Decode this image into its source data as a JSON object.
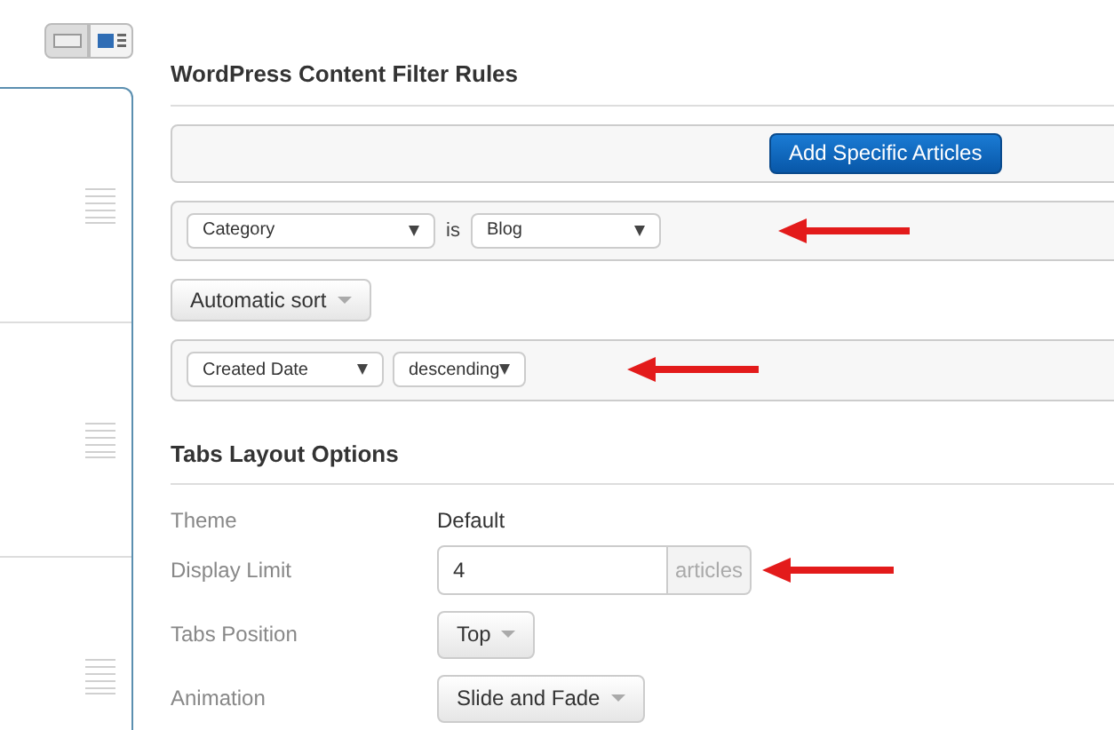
{
  "view_toggle": [
    {
      "kind": "plain",
      "selected": false
    },
    {
      "kind": "list",
      "selected": true
    }
  ],
  "filter_rules": {
    "title": "WordPress Content Filter Rules",
    "add_button": "Add Specific Articles",
    "condition": {
      "field": "Category",
      "operator": "is",
      "value": "Blog"
    },
    "sort_button": "Automatic sort",
    "sort": {
      "field": "Created Date",
      "order": "descending"
    }
  },
  "layout_options": {
    "title": "Tabs Layout Options",
    "rows": [
      {
        "kind": "text",
        "label": "Theme",
        "value": "Default"
      },
      {
        "kind": "input",
        "label": "Display Limit",
        "value": "4",
        "addon": "articles"
      },
      {
        "kind": "dropdown",
        "label": "Tabs Position",
        "value": "Top"
      },
      {
        "kind": "dropdown",
        "label": "Animation",
        "value": "Slide and Fade"
      }
    ]
  }
}
